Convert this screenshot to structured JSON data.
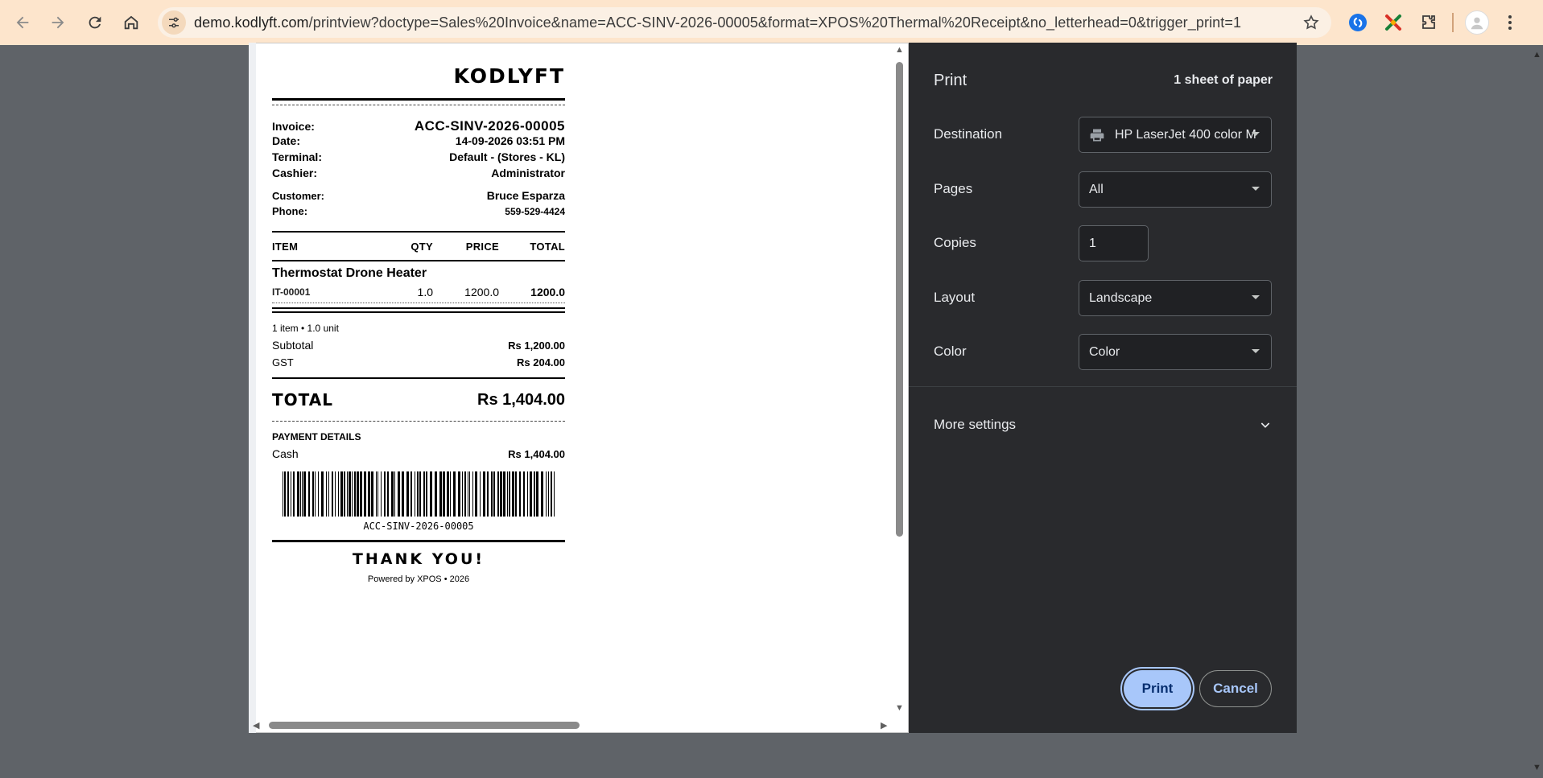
{
  "browser": {
    "url_host": "demo.kodlyft.com",
    "url_path": "/printview?doctype=Sales%20Invoice&name=ACC-SINV-2026-00005&format=XPOS%20Thermal%20Receipt&no_letterhead=0&trigger_print=1"
  },
  "receipt": {
    "brand": "KODLYFT",
    "invoice_label": "Invoice:",
    "invoice_no": "ACC-SINV-2026-00005",
    "date_label": "Date:",
    "date": "14-09-2026 03:51 PM",
    "terminal_label": "Terminal:",
    "terminal": "Default - (Stores - KL)",
    "cashier_label": "Cashier:",
    "cashier": "Administrator",
    "customer_label": "Customer:",
    "customer": "Bruce Esparza",
    "phone_label": "Phone:",
    "phone": "559-529-4424",
    "columns": [
      "ITEM",
      "QTY",
      "PRICE",
      "TOTAL"
    ],
    "items": [
      {
        "name": "Thermostat Drone Heater",
        "code": "IT-00001",
        "qty": "1.0",
        "price": "1200.0",
        "total": "1200.0"
      }
    ],
    "summary_count": "1 item • 1.0 unit",
    "subtotal_label": "Subtotal",
    "subtotal": "Rs 1,200.00",
    "tax_label": "GST",
    "tax": "Rs 204.00",
    "total_label": "TOTAL",
    "total": "Rs 1,404.00",
    "payment_heading": "PAYMENT DETAILS",
    "payment_method": "Cash",
    "payment_amount": "Rs 1,404.00",
    "barcode_text": "ACC-SINV-2026-00005",
    "thank_you": "THANK YOU!",
    "powered_by": "Powered by XPOS • 2026"
  },
  "print_panel": {
    "title": "Print",
    "sheets": "1 sheet of paper",
    "destination_label": "Destination",
    "destination_value": "HP LaserJet 400 color M",
    "pages_label": "Pages",
    "pages_value": "All",
    "copies_label": "Copies",
    "copies_value": "1",
    "layout_label": "Layout",
    "layout_value": "Landscape",
    "color_label": "Color",
    "color_value": "Color",
    "more_settings": "More settings",
    "print_button": "Print",
    "cancel_button": "Cancel"
  },
  "icons": [
    "back-icon",
    "forward-icon",
    "reload-icon",
    "home-icon",
    "site-info-icon",
    "star-icon",
    "extension-icons",
    "puzzle-icon",
    "avatar",
    "kebab-menu-icon",
    "printer-icon",
    "chevron-down-icon"
  ]
}
